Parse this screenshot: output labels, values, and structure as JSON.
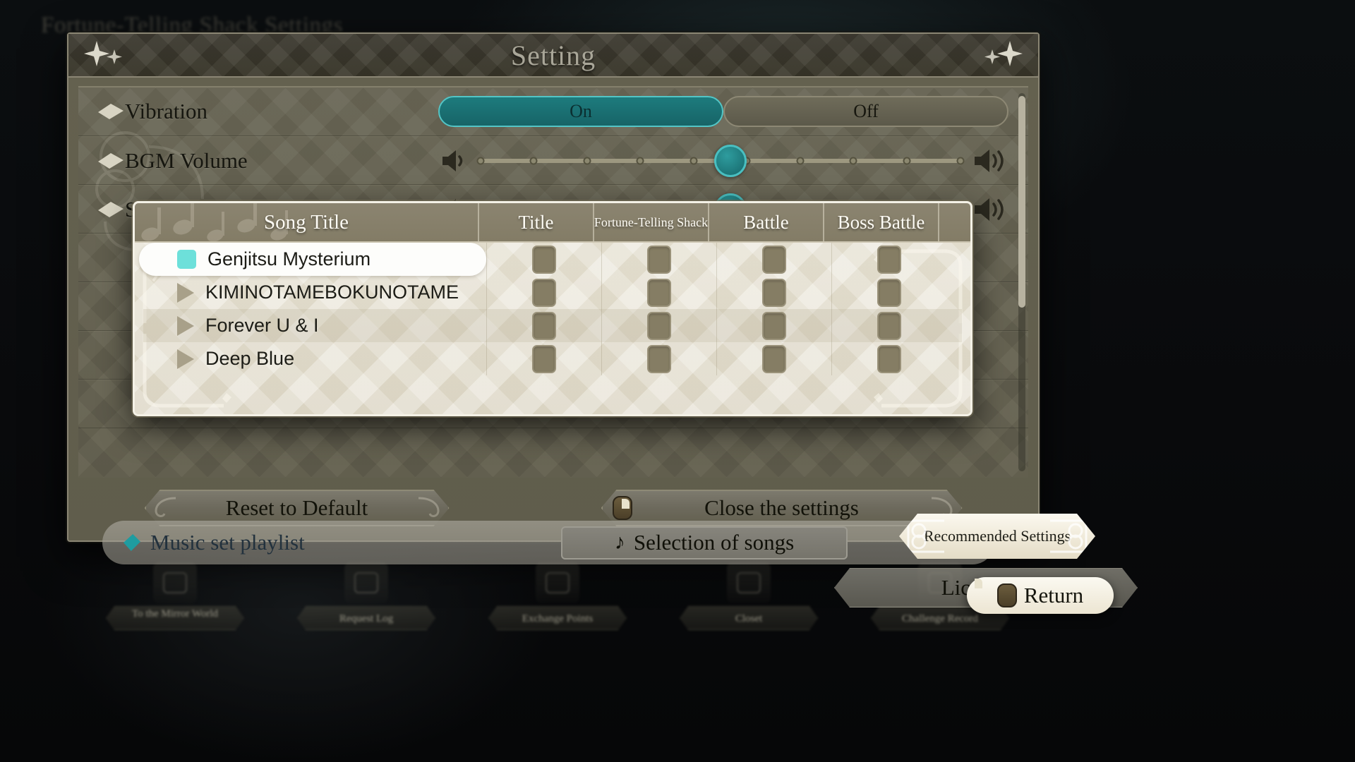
{
  "background": {
    "page_title": "Fortune-Telling Shack Settings",
    "hud_items": [
      {
        "label": "To the Mirror World",
        "icon": "mirror-icon"
      },
      {
        "label": "Request Log",
        "icon": "scroll-icon"
      },
      {
        "label": "Exchange Points",
        "icon": "point-icon"
      },
      {
        "label": "Closet",
        "icon": "wardrobe-icon"
      },
      {
        "label": "Challenge Record",
        "icon": "record-icon"
      }
    ]
  },
  "modal": {
    "title": "Setting",
    "settings": [
      {
        "label": "Vibration",
        "type": "toggle",
        "options": [
          "On",
          "Off"
        ],
        "value": "On"
      },
      {
        "label": "BGM Volume",
        "type": "slider",
        "ticks": 10,
        "value": 5
      },
      {
        "label": "SE Volume",
        "type": "slider",
        "ticks": 10,
        "value": 5
      }
    ],
    "footer": {
      "reset_label": "Reset to Default",
      "close_label": "Close the settings",
      "close_icon": "mouse-button-icon"
    }
  },
  "song_panel": {
    "columns": [
      "Song Title",
      "Title",
      "Fortune-Telling Shack",
      "Battle",
      "Boss Battle"
    ],
    "rows": [
      {
        "title": "Genjitsu Mysterium",
        "state_icon": "stop-icon",
        "selected": true,
        "checks": [
          false,
          false,
          false,
          false
        ]
      },
      {
        "title": "KIMINOTAMEBOKUNOTAME",
        "state_icon": "play-icon",
        "selected": false,
        "checks": [
          false,
          false,
          false,
          false
        ]
      },
      {
        "title": "Forever U & I",
        "state_icon": "play-icon",
        "selected": false,
        "checks": [
          false,
          false,
          false,
          false
        ]
      },
      {
        "title": "Deep Blue",
        "state_icon": "play-icon",
        "selected": false,
        "checks": [
          false,
          false,
          false,
          false
        ]
      }
    ]
  },
  "playlist": {
    "label": "Music set playlist",
    "bullet_icon": "diamond-bullet-icon",
    "button_label": "Selection of songs",
    "button_icon": "music-note-icon"
  },
  "floating": {
    "recommended_label": "Recommended Settings",
    "license_label": "License N",
    "return_label": "Return",
    "return_icon": "mouse-button-icon"
  },
  "colors": {
    "accent_teal": "#1d7b7d",
    "knob_teal": "#2e9c9e",
    "stop_cyan": "#6de0da",
    "panel_cream": "#e7e2d4",
    "modal_olive": "#64614f",
    "header_dark": "#3b382d"
  }
}
